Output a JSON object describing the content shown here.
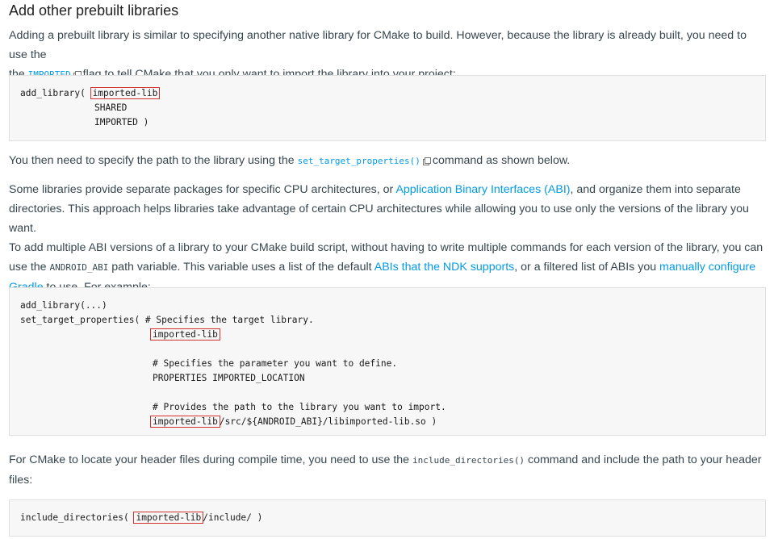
{
  "heading": "Add other prebuilt libraries",
  "para1": {
    "text_a": "Adding a prebuilt library is similar to specifying another native library for CMake to build. However, because the library is already built, you need to use the",
    "code": "IMPORTED",
    "text_b": "flag to tell CMake that you only want to import the library into your project:"
  },
  "code1": {
    "line1_a": "add_library( ",
    "line1_hl": "imported-lib",
    "line2": "SHARED",
    "line3": "IMPORTED )"
  },
  "para2": {
    "text_a": "You then need to specify the path to the library using the",
    "code": "set_target_properties()",
    "text_b": "command as shown below."
  },
  "para3": {
    "line1_a": "Some libraries provide separate packages for specific CPU architectures, or ",
    "link_abi": "Application Binary Interfaces (ABI)",
    "line1_b": ", and organize them into separate",
    "line2": "directories. This approach helps libraries take advantage of certain CPU architectures while allowing you to use only the versions of the library you want.",
    "line3": "To add multiple ABI versions of a library to your CMake build script, without having to write multiple commands for each version of the library, you can",
    "line4_a": "use the ",
    "code": "ANDROID_ABI",
    "line4_b": " path variable. This variable uses a list of the default ",
    "link_ndk": "ABIs that the NDK supports",
    "line4_c": ", or a filtered list of ABIs you ",
    "link_gradle_a": "manually configure",
    "link_gradle_b": "Gradle",
    "line5": " to use. For example:"
  },
  "code2": {
    "l1": "add_library(...)",
    "l2": "set_target_properties( # Specifies the target library.",
    "l3_hl": "imported-lib",
    "l5": "# Specifies the parameter you want to define.",
    "l6": "PROPERTIES IMPORTED_LOCATION",
    "l8": "# Provides the path to the library you want to import.",
    "l9_hl": "imported-lib",
    "l9_rest": "/src/${ANDROID_ABI}/libimported-lib.so )"
  },
  "para4": {
    "text_a": "For CMake to locate your header files during compile time, you need to use the ",
    "code": "include_directories()",
    "text_b": " command and include the path to your header",
    "line2": "files:"
  },
  "code3": {
    "a": "include_directories( ",
    "hl": "imported-lib",
    "b": "/include/ )"
  },
  "icons": {
    "external": "external-link-icon"
  },
  "colors": {
    "link": "#039be5",
    "highlight_border": "#d32f2f",
    "code_bg": "#f7f7f7"
  }
}
